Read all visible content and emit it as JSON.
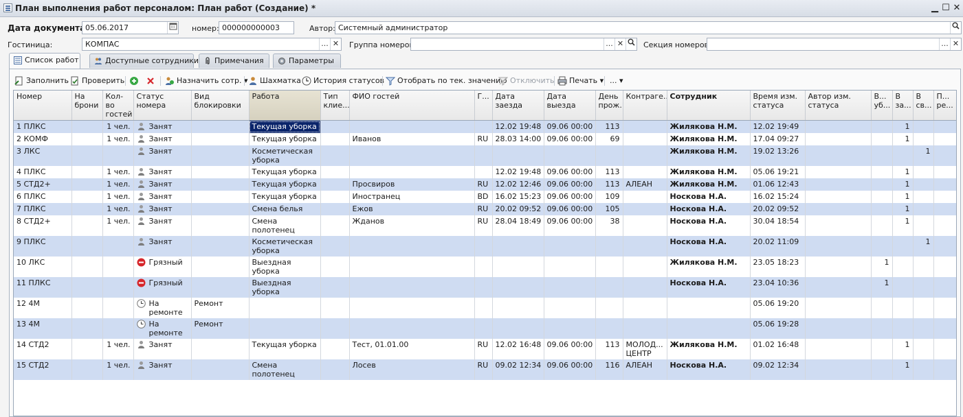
{
  "window": {
    "title": "План выполнения работ персоналом: План работ (Создание) *",
    "minimize": "▁",
    "maximize": "☐",
    "close": "✕"
  },
  "header": {
    "doc_date_label": "Дата документа:",
    "doc_date_value": "05.06.2017",
    "number_label": "номер:",
    "number_value": "000000000003",
    "author_label": "Автор:",
    "author_value": "Системный администратор",
    "hotel_label": "Гостиница:",
    "hotel_value": "КОМПАС",
    "room_group_label": "Группа номеров:",
    "room_group_value": "",
    "room_section_label": "Секция номеров:",
    "room_section_value": "",
    "ellipsis": "...",
    "clear": "✕"
  },
  "tabs": [
    {
      "label": "Список работ"
    },
    {
      "label": "Доступные сотрудники"
    },
    {
      "label": "Примечания"
    },
    {
      "label": "Параметры"
    }
  ],
  "toolbar": {
    "fill": "Заполнить",
    "check": "Проверить",
    "assign": "Назначить сотр.",
    "chess": "Шахматка",
    "status_history": "История статусов",
    "filter_by_value": "Отобрать по тек. значению",
    "disable": "Отключить",
    "print": "Печать",
    "more": "..."
  },
  "colors": {
    "alt_row": "#cfdcf2",
    "selected_cell": "#0a246a",
    "dirty_status": "#d6262b"
  },
  "table": {
    "columns": [
      "Номер",
      "На брони",
      "Кол-во гостей",
      "Статус номера",
      "Вид блокировки",
      "Работа",
      "Тип клие...",
      "ФИО гостей",
      "Г...",
      "Дата заезда",
      "Дата выезда",
      "День прож.",
      "Контраге...",
      "Сотрудник",
      "Время изм. статуса",
      "Автор изм. статуса",
      "В... уб...",
      "В за...",
      "В св...",
      "П... ре..."
    ],
    "rows": [
      {
        "room": "1 ПЛКС",
        "guests_count": "1 чел.",
        "status": "Занят",
        "status_icon": "person-icon",
        "block": "",
        "work": "Текущая уборка",
        "client_type": "",
        "guest": "",
        "country": "",
        "arrival": "12.02 19:48",
        "departure": "09.06 00:00",
        "days": "113",
        "contractor": "",
        "employee": "Жилякова Н.М.",
        "status_time": "12.02 19:49",
        "status_author": "",
        "c1": "",
        "c2": "1",
        "c3": "",
        "c4": ""
      },
      {
        "room": "2 КОМФ",
        "guests_count": "1 чел.",
        "status": "Занят",
        "status_icon": "person-icon",
        "block": "",
        "work": "Текущая уборка",
        "client_type": "",
        "guest": "Иванов",
        "country": "RU",
        "arrival": "28.03 14:00",
        "departure": "09.06 00:00",
        "days": "69",
        "contractor": "",
        "employee": "Жилякова Н.М.",
        "status_time": "17.04 09:27",
        "status_author": "",
        "c1": "",
        "c2": "1",
        "c3": "",
        "c4": ""
      },
      {
        "room": "3 ЛКС",
        "guests_count": "",
        "status": "Занят",
        "status_icon": "person-icon",
        "block": "",
        "work": "Косметическая уборка",
        "client_type": "",
        "guest": "",
        "country": "",
        "arrival": "",
        "departure": "",
        "days": "",
        "contractor": "",
        "employee": "Жилякова Н.М.",
        "status_time": "19.02 13:26",
        "status_author": "",
        "c1": "",
        "c2": "",
        "c3": "1",
        "c4": ""
      },
      {
        "room": "4 ПЛКС",
        "guests_count": "1 чел.",
        "status": "Занят",
        "status_icon": "person-icon",
        "block": "",
        "work": "Текущая уборка",
        "client_type": "",
        "guest": "",
        "country": "",
        "arrival": "12.02 19:48",
        "departure": "09.06 00:00",
        "days": "113",
        "contractor": "",
        "employee": "Жилякова Н.М.",
        "status_time": "05.06 19:21",
        "status_author": "",
        "c1": "",
        "c2": "1",
        "c3": "",
        "c4": ""
      },
      {
        "room": "5 СТД2+",
        "guests_count": "1 чел.",
        "status": "Занят",
        "status_icon": "person-icon",
        "block": "",
        "work": "Текущая уборка",
        "client_type": "",
        "guest": "Просвиров",
        "country": "RU",
        "arrival": "12.02 12:46",
        "departure": "09.06 00:00",
        "days": "113",
        "contractor": "АЛЕАН",
        "employee": "Жилякова Н.М.",
        "status_time": "01.06 12:43",
        "status_author": "",
        "c1": "",
        "c2": "1",
        "c3": "",
        "c4": ""
      },
      {
        "room": "6 ПЛКС",
        "guests_count": "1 чел.",
        "status": "Занят",
        "status_icon": "person-icon",
        "block": "",
        "work": "Текущая уборка",
        "client_type": "",
        "guest": "Иностранец",
        "country": "BD",
        "arrival": "16.02 15:23",
        "departure": "09.06 00:00",
        "days": "109",
        "contractor": "",
        "employee": "Носкова Н.А.",
        "status_time": "16.02 15:24",
        "status_author": "",
        "c1": "",
        "c2": "1",
        "c3": "",
        "c4": ""
      },
      {
        "room": "7 ПЛКС",
        "guests_count": "1 чел.",
        "status": "Занят",
        "status_icon": "person-icon",
        "block": "",
        "work": "Смена белья",
        "client_type": "",
        "guest": "Ежов",
        "country": "RU",
        "arrival": "20.02 09:52",
        "departure": "09.06 00:00",
        "days": "105",
        "contractor": "",
        "employee": "Носкова Н.А.",
        "status_time": "20.02 09:52",
        "status_author": "",
        "c1": "",
        "c2": "1",
        "c3": "",
        "c4": ""
      },
      {
        "room": "8 СТД2+",
        "guests_count": "1 чел.",
        "status": "Занят",
        "status_icon": "person-icon",
        "block": "",
        "work": "Смена полотенец",
        "client_type": "",
        "guest": "Жданов",
        "country": "RU",
        "arrival": "28.04 18:49",
        "departure": "09.06 00:00",
        "days": "38",
        "contractor": "",
        "employee": "Носкова Н.А.",
        "status_time": "30.04 18:54",
        "status_author": "",
        "c1": "",
        "c2": "1",
        "c3": "",
        "c4": ""
      },
      {
        "room": "9 ПЛКС",
        "guests_count": "",
        "status": "Занят",
        "status_icon": "person-icon",
        "block": "",
        "work": "Косметическая уборка",
        "client_type": "",
        "guest": "",
        "country": "",
        "arrival": "",
        "departure": "",
        "days": "",
        "contractor": "",
        "employee": "Носкова Н.А.",
        "status_time": "20.02 11:09",
        "status_author": "",
        "c1": "",
        "c2": "",
        "c3": "1",
        "c4": ""
      },
      {
        "room": "10 ЛКС",
        "guests_count": "",
        "status": "Грязный",
        "status_icon": "no-entry-icon",
        "block": "",
        "work": "Выездная уборка",
        "client_type": "",
        "guest": "",
        "country": "",
        "arrival": "",
        "departure": "",
        "days": "",
        "contractor": "",
        "employee": "Жилякова Н.М.",
        "status_time": "23.05 18:23",
        "status_author": "",
        "c1": "1",
        "c2": "",
        "c3": "",
        "c4": ""
      },
      {
        "room": "11 ПЛКС",
        "guests_count": "",
        "status": "Грязный",
        "status_icon": "no-entry-icon",
        "block": "",
        "work": "Выездная уборка",
        "client_type": "",
        "guest": "",
        "country": "",
        "arrival": "",
        "departure": "",
        "days": "",
        "contractor": "",
        "employee": "Носкова Н.А.",
        "status_time": "23.04 10:36",
        "status_author": "",
        "c1": "1",
        "c2": "",
        "c3": "",
        "c4": ""
      },
      {
        "room": "12 4М",
        "guests_count": "",
        "status": "На ремонте",
        "status_icon": "clock-icon",
        "block": "Ремонт",
        "work": "",
        "client_type": "",
        "guest": "",
        "country": "",
        "arrival": "",
        "departure": "",
        "days": "",
        "contractor": "",
        "employee": "",
        "status_time": "05.06 19:20",
        "status_author": "",
        "c1": "",
        "c2": "",
        "c3": "",
        "c4": ""
      },
      {
        "room": "13 4М",
        "guests_count": "",
        "status": "На ремонте",
        "status_icon": "clock-icon",
        "block": "Ремонт",
        "work": "",
        "client_type": "",
        "guest": "",
        "country": "",
        "arrival": "",
        "departure": "",
        "days": "",
        "contractor": "",
        "employee": "",
        "status_time": "05.06 19:28",
        "status_author": "",
        "c1": "",
        "c2": "",
        "c3": "",
        "c4": ""
      },
      {
        "room": "14 СТД2",
        "guests_count": "1 чел.",
        "status": "Занят",
        "status_icon": "person-icon",
        "block": "",
        "work": "Текущая уборка",
        "client_type": "",
        "guest": "Тест, 01.01.00",
        "country": "RU",
        "arrival": "12.02 16:48",
        "departure": "09.06 00:00",
        "days": "113",
        "contractor": "МОЛОД... ЦЕНТР",
        "employee": "Жилякова Н.М.",
        "status_time": "01.02 16:48",
        "status_author": "",
        "c1": "",
        "c2": "1",
        "c3": "",
        "c4": ""
      },
      {
        "room": "15 СТД2",
        "guests_count": "1 чел.",
        "status": "Занят",
        "status_icon": "person-icon",
        "block": "",
        "work": "Смена полотенец",
        "client_type": "",
        "guest": "Лосев",
        "country": "RU",
        "arrival": "09.02 12:34",
        "departure": "09.06 00:00",
        "days": "116",
        "contractor": "АЛЕАН",
        "employee": "Носкова Н.А.",
        "status_time": "09.02 12:34",
        "status_author": "",
        "c1": "",
        "c2": "1",
        "c3": "",
        "c4": ""
      }
    ]
  }
}
